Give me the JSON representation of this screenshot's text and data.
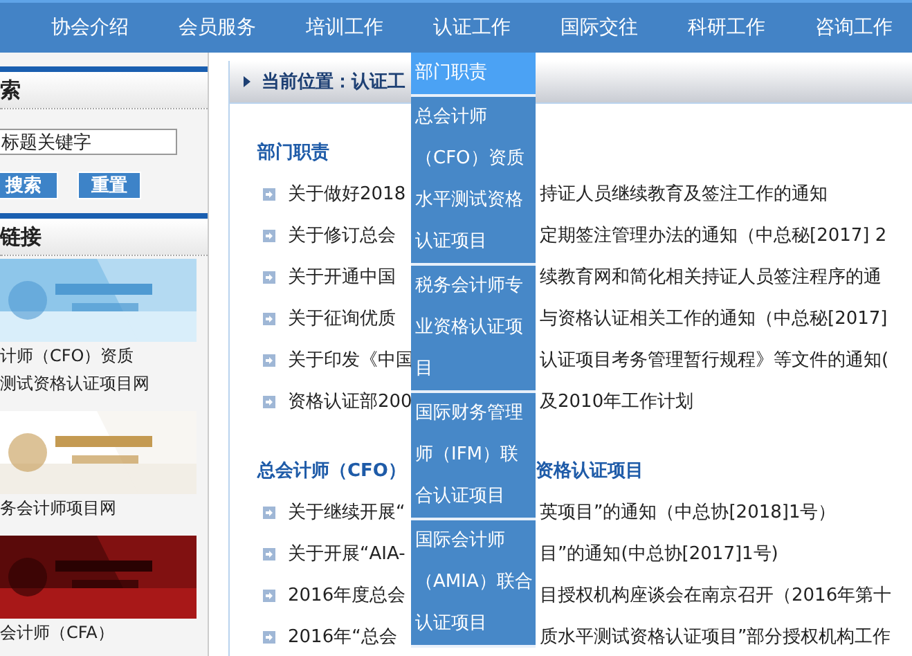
{
  "nav": {
    "items": [
      "协会介绍",
      "会员服务",
      "培训工作",
      "认证工作",
      "国际交往",
      "科研工作",
      "咨询工作"
    ]
  },
  "dropdown": {
    "items": [
      {
        "label": "部门职责",
        "selected": true
      },
      {
        "label": "总会计师（CFO）资质水平测试资格认证项目",
        "selected": false
      },
      {
        "label": "税务会计师专业资格认证项目",
        "selected": false
      },
      {
        "label": "国际财务管理师（IFM）联合认证项目",
        "selected": false
      },
      {
        "label": "国际会计师（AMIA）联合认证项目",
        "selected": false
      }
    ]
  },
  "sidebar": {
    "search_title": "索",
    "search": {
      "placeholder": "标题关键字"
    },
    "buttons": [
      "搜索",
      "重置"
    ],
    "links_title": "链接",
    "links": [
      {
        "kind": "picture",
        "caption": [
          "计师（CFO）资质",
          "测试资格认证项目网"
        ]
      },
      {
        "kind": "picture",
        "caption": [
          "务会计师项目网"
        ]
      },
      {
        "kind": "picture",
        "caption": [
          "会计师（CFA）"
        ]
      }
    ]
  },
  "breadcrumb": "当前位置：认证工",
  "sections": [
    {
      "heading": [
        "部门职责"
      ],
      "items": [
        [
          "关于做好2018",
          "持证人员继续教育及签注工作的通知"
        ],
        [
          "关于修订总会",
          "定期签注管理办法的通知（中总秘[2017] 2"
        ],
        [
          "关于开通中国",
          "续教育网和简化相关持证人员签注程序的通"
        ],
        [
          "关于征询优质",
          "与资格认证相关工作的通知（中总秘[2017]"
        ],
        [
          "关于印发《中国",
          "认证项目考务管理暂行规程》等文件的通知("
        ],
        [
          "资格认证部200",
          "及2010年工作计划"
        ]
      ]
    },
    {
      "heading": [
        "总会计师（CFO）",
        "资格认证项目"
      ],
      "items": [
        [
          "关于继续开展“",
          "英项目”的通知（中总协[2018]1号）"
        ],
        [
          "关于开展“AIA-",
          "目”的通知(中总协[2017]1号)"
        ],
        [
          "2016年度总会",
          "目授权机构座谈会在南京召开（2016年第十"
        ],
        [
          "2016年“总会",
          "质水平测试资格认证项目”部分授权机构工作"
        ]
      ]
    }
  ]
}
